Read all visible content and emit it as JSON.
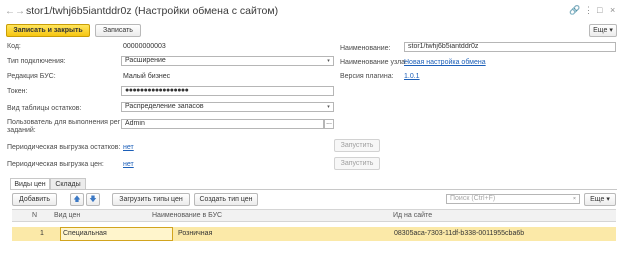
{
  "window": {
    "title": "stor1/twhj6b5iantddr0z (Настройки обмена с сайтом)",
    "star_glyph": "☆",
    "link_glyph": "🔗",
    "more_glyph": "⋮",
    "maximize_glyph": "□",
    "close_glyph": "×",
    "back_glyph": "←",
    "forward_glyph": "→"
  },
  "toolbar": {
    "save_close": "Записать и закрыть",
    "save": "Записать",
    "more": "Еще",
    "more_arrow": "▾"
  },
  "form": {
    "code_label": "Код:",
    "code_value": "00000000003",
    "conn_type_label": "Тип подключения:",
    "conn_type_value": "Расширение",
    "bus_edition_label": "Редакция БУС:",
    "bus_edition_value": "Малый бизнес",
    "token_label": "Токен:",
    "token_value": "●●●●●●●●●●●●●●●●●",
    "stock_table_label": "Вид таблицы остатков:",
    "stock_table_value": "Распределение запасов",
    "user_label_line1": "Пользователь для выполнения рег",
    "user_label_line2": "заданий:",
    "user_value": "Admin",
    "user_select": "...",
    "periodic_stock_label": "Периодическая выгрузка остатков:",
    "periodic_stock_value": "нет",
    "periodic_price_label": "Периодическая выгрузка цен:",
    "periodic_price_value": "нет",
    "run_label": "Запустить",
    "name_label": "Наименование:",
    "name_value": "stor1/twhj6b5iantddr0z",
    "node_name_label": "Наименование узла:",
    "node_name_value": "Новая настройка обмена",
    "plugin_version_label": "Версия плагина:",
    "plugin_version_value": "1.0.1",
    "dropdown_glyph": "▾"
  },
  "tabs": [
    {
      "label": "Виды цен"
    },
    {
      "label": "Склады"
    }
  ],
  "table_toolbar": {
    "add": "Добавить",
    "up_glyph": "🡅",
    "down_glyph": "🡇",
    "load_types": "Загрузить типы цен",
    "create_type": "Создать тип цен",
    "search_placeholder": "Поиск (Ctrl+F)",
    "search_clear": "×",
    "more": "Еще",
    "more_arrow": "▾"
  },
  "table": {
    "columns": [
      "N",
      "Вид цен",
      "Наименование в БУС",
      "Ид на сайте"
    ],
    "rows": [
      {
        "n": "1",
        "price_type": "Специальная",
        "bus_name": "Розничная",
        "site_id": "08305aca-7303-11df-b338-0011955cba6b"
      }
    ]
  }
}
